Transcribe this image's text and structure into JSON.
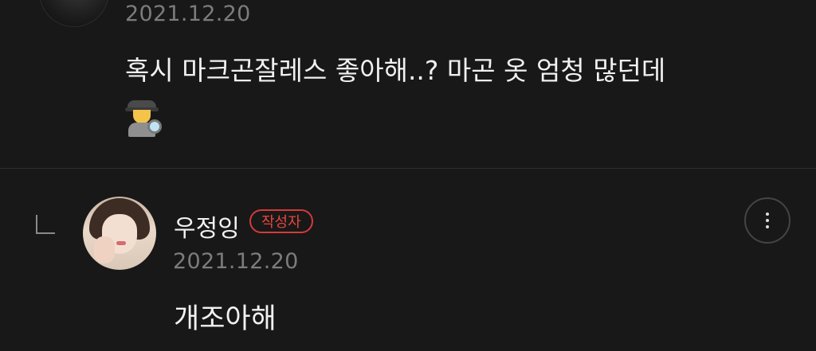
{
  "comment": {
    "date": "2021.12.20",
    "body": "혹시 마크곤잘레스 좋아해..? 마곤 옷 엄청 많던데",
    "emoji": "detective-icon"
  },
  "reply": {
    "author": "우정잉",
    "badge": "작성자",
    "date": "2021.12.20",
    "body": "개조아해"
  },
  "colors": {
    "background": "#181818",
    "badge": "#e5483f",
    "muted_text": "#7c7c7c"
  }
}
